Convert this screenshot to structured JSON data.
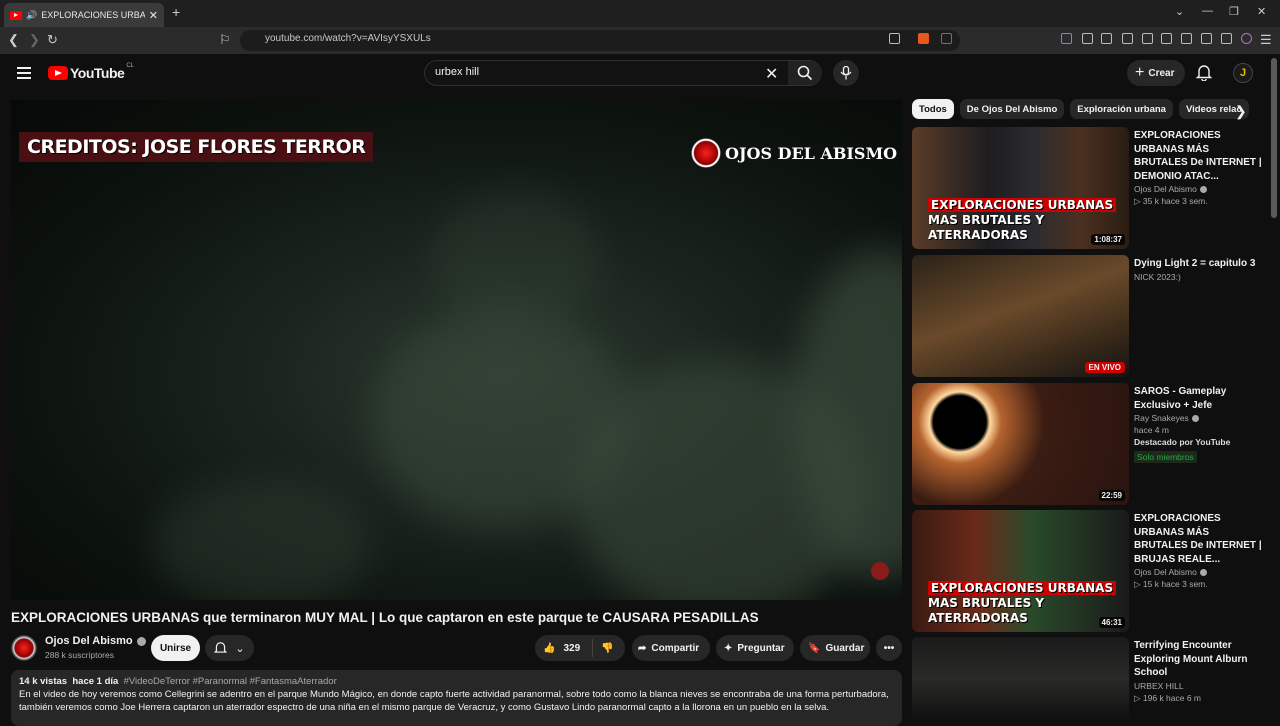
{
  "browser": {
    "tab_title": "EXPLORACIONES URBANAS q",
    "url": "youtube.com/watch?v=AVIsyYSXULs"
  },
  "masthead": {
    "logo_text": "YouTube",
    "country_code": "CL",
    "search_value": "urbex hill",
    "create_label": "Crear",
    "avatar_letter": "J"
  },
  "video": {
    "overlay_credits": "CREDITOS: JOSE FLORES TERROR",
    "overlay_brand": "OJOS DEL ABISMO",
    "title": "EXPLORACIONES URBANAS que terminaron MUY MAL | Lo que captaron en este parque te CAUSARA PESADILLAS",
    "channel": "Ojos Del Abismo",
    "subscribers": "288 k suscriptores",
    "join_label": "Unirse",
    "likes": "329",
    "share_label": "Compartir",
    "ask_label": "Preguntar",
    "save_label": "Guardar",
    "views": "14 k vistas",
    "age": "hace 1 día",
    "hashtags": "#VideoDeTerror #Paranormal #FantasmaAterrador",
    "description_line1": "En el video de hoy veremos como Cellegrini se adentro en el parque Mundo Mágico, en donde capto fuerte actividad paranormal, sobre todo como la blanca nieves se encontraba de una forma perturbadora,",
    "description_line2": "también veremos como Joe Herrera captaron un aterrador espectro de una niña en el mismo parque de Veracruz, y como Gustavo Lindo paranormal capto a la llorona en un pueblo en la selva."
  },
  "chips": [
    "Todos",
    "De Ojos Del Abismo",
    "Exploración urbana",
    "Videos relac"
  ],
  "recommendations": [
    {
      "title": "EXPLORACIONES URBANAS MÁS BRUTALES De INTERNET | DEMONIO ATAC...",
      "channel": "Ojos Del Abismo",
      "meta": "▷ 35 k  hace 3 sem.",
      "duration": "1:08:37",
      "thumb_line1": "EXPLORACIONES URBANAS",
      "thumb_line2": "MAS BRUTALES Y ATERRADORAS"
    },
    {
      "title": "Dying Light 2 = capitulo 3",
      "channel": "NICK 2023:)",
      "live": "EN VIVO"
    },
    {
      "title": "SAROS - Gameplay Exclusivo + Jefe",
      "channel": "Ray Snakeyes",
      "meta": "hace 4 m",
      "badge1": "Destacado por YouTube",
      "badge2": "Solo miembros",
      "duration": "22:59"
    },
    {
      "title": "EXPLORACIONES URBANAS MÁS BRUTALES De INTERNET  | BRUJAS REALE...",
      "channel": "Ojos Del Abismo",
      "meta": "▷ 15 k  hace 3 sem.",
      "duration": "46:31",
      "thumb_line1": "EXPLORACIONES URBANAS",
      "thumb_line2": "MAS BRUTALES Y ATERRADORAS"
    },
    {
      "title": "Terrifying Encounter Exploring Mount Alburn School",
      "channel": "URBEX HILL",
      "meta": "▷ 196 k  hace 6 m"
    }
  ]
}
